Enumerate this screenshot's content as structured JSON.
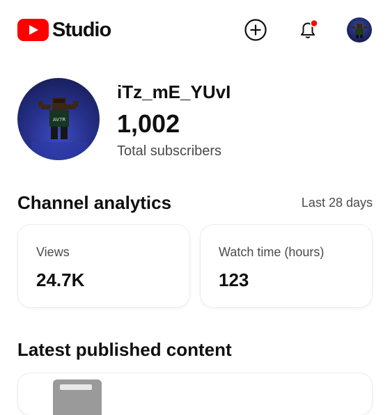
{
  "header": {
    "brand": "Studio",
    "create_icon": "add-circle-icon",
    "notifications_icon": "bell-icon",
    "notification_badge_color": "#ff0000",
    "brand_color": "#ff0000"
  },
  "channel": {
    "name": "iTz_mE_YUvI",
    "subscriber_count": "1,002",
    "subscriber_label": "Total subscribers"
  },
  "analytics": {
    "title": "Channel analytics",
    "range": "Last 28 days",
    "cards": [
      {
        "label": "Views",
        "value": "24.7K"
      },
      {
        "label": "Watch time (hours)",
        "value": "123"
      }
    ]
  },
  "latest": {
    "title": "Latest published content"
  }
}
